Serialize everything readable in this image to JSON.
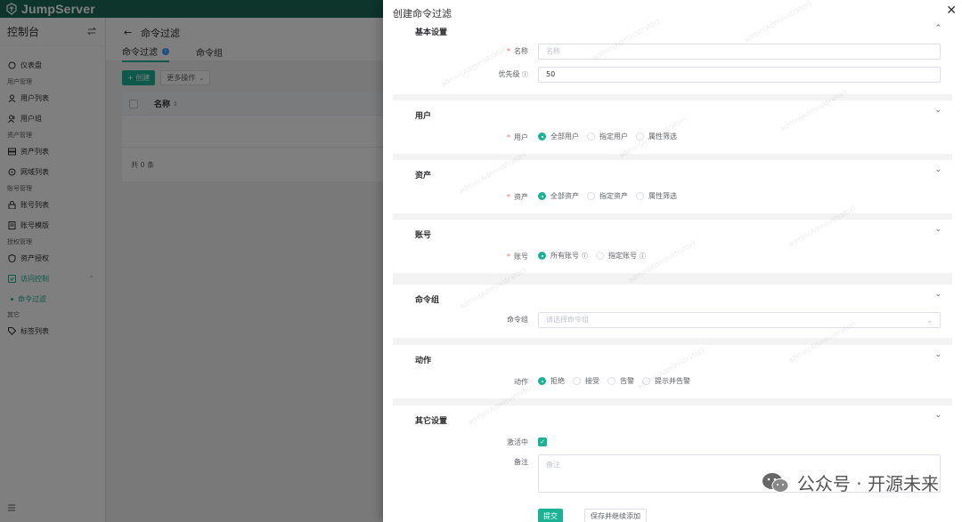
{
  "app": {
    "brand": "JumpServer"
  },
  "sidebar": {
    "title": "控制台",
    "groups": [
      {
        "items": [
          {
            "label": "仪表盘",
            "icon": "dashboard-icon"
          }
        ]
      },
      {
        "label": "用户管理",
        "items": [
          {
            "label": "用户列表",
            "icon": "user-icon"
          },
          {
            "label": "用户组",
            "icon": "users-icon"
          }
        ]
      },
      {
        "label": "资产管理",
        "items": [
          {
            "label": "资产列表",
            "icon": "server-icon"
          },
          {
            "label": "网域列表",
            "icon": "network-icon"
          }
        ]
      },
      {
        "label": "账号管理",
        "items": [
          {
            "label": "账号列表",
            "icon": "lock-icon"
          },
          {
            "label": "账号模版",
            "icon": "template-icon"
          }
        ]
      },
      {
        "label": "授权管理",
        "items": [
          {
            "label": "资产授权",
            "icon": "shield-icon"
          },
          {
            "label": "访问控制",
            "icon": "access-control-icon"
          }
        ],
        "sub": "命令过滤"
      },
      {
        "label": "其它",
        "items": [
          {
            "label": "标签列表",
            "icon": "tag-icon"
          }
        ]
      }
    ]
  },
  "main": {
    "title": "命令过滤",
    "tabs": [
      {
        "label": "命令过滤"
      },
      {
        "label": "命令组"
      }
    ],
    "create_label": "+ 创建",
    "more_label": "更多操作",
    "table": {
      "col_name": "名称",
      "footer": "共 0 条"
    }
  },
  "drawer": {
    "title": "创建命令过滤",
    "sections": {
      "basic": {
        "title": "基本设置",
        "name_label": "名称",
        "name_placeholder": "名称",
        "priority_label": "优先级",
        "priority_value": "50"
      },
      "user": {
        "title": "用户",
        "label": "用户",
        "options": [
          "全部用户",
          "指定用户",
          "属性筛选"
        ]
      },
      "asset": {
        "title": "资产",
        "label": "资产",
        "options": [
          "全部资产",
          "指定资产",
          "属性筛选"
        ]
      },
      "account": {
        "title": "账号",
        "label": "账号",
        "options": [
          "所有账号",
          "指定账号"
        ]
      },
      "cmdgroup": {
        "title": "命令组",
        "label": "命令组",
        "placeholder": "请选择命令组"
      },
      "action": {
        "title": "动作",
        "label": "动作",
        "options": [
          "拒绝",
          "接受",
          "告警",
          "提示并告警"
        ]
      },
      "other": {
        "title": "其它设置",
        "active_label": "激活中",
        "comment_label": "备注",
        "comment_placeholder": "备注"
      }
    },
    "submit_label": "提交",
    "save_continue_label": "保存并继续添加"
  },
  "watermark": {
    "text": "admin(Administrator)",
    "brand_overlay": "公众号 · 开源未来"
  },
  "colors": {
    "brand": "#1a6b56",
    "accent": "#1ab394",
    "required": "#f56c6c"
  }
}
